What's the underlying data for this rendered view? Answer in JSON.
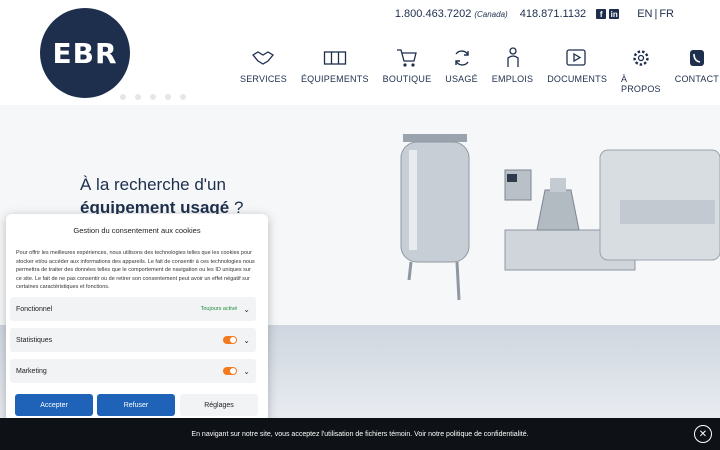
{
  "brand": {
    "logo_text": "EBR"
  },
  "topbar": {
    "phone": "1.800.463.7202",
    "phone_note": "(Canada)",
    "phone2": "418.871.1132",
    "lang_en": "EN",
    "lang_sep": "|",
    "lang_fr": "FR"
  },
  "nav": [
    {
      "label": "SERVICES",
      "icon": "handshake-icon"
    },
    {
      "label": "ÉQUIPEMENTS",
      "icon": "catalog-icon"
    },
    {
      "label": "BOUTIQUE",
      "icon": "cart-icon"
    },
    {
      "label": "USAGÉ",
      "icon": "recycle-icon"
    },
    {
      "label": "EMPLOIS",
      "icon": "person-icon"
    },
    {
      "label": "DOCUMENTS",
      "icon": "video-doc-icon"
    },
    {
      "label": "À PROPOS",
      "icon": "gear-icon"
    },
    {
      "label": "CONTACT",
      "icon": "phone-icon"
    }
  ],
  "hero": {
    "line1": "À la recherche d'un",
    "line2_bold": "équipement usagé",
    "line2_rest": " ?"
  },
  "consent": {
    "title": "Gestion du consentement aux cookies",
    "body": "Pour offrir les meilleures expériences, nous utilisons des technologies telles que les cookies pour stocker et/ou accéder aux informations des appareils. Le fait de consentir à ces technologies nous permettra de traiter des données telles que le comportement de navigation ou les ID uniques sur ce site. Le fait de ne pas consentir ou de retirer son consentement peut avoir un effet négatif sur certaines caractéristiques et fonctions.",
    "sections": [
      {
        "label": "Fonctionnel",
        "status": "Toujours activé"
      },
      {
        "label": "Statistiques"
      },
      {
        "label": "Marketing"
      }
    ],
    "accept": "Accepter",
    "refuse": "Refuser",
    "settings": "Réglages"
  },
  "cookiebar": {
    "text": "En navigant sur notre site, vous acceptez l'utilisation de fichiers témoin. Voir notre politique de confidentialité."
  }
}
